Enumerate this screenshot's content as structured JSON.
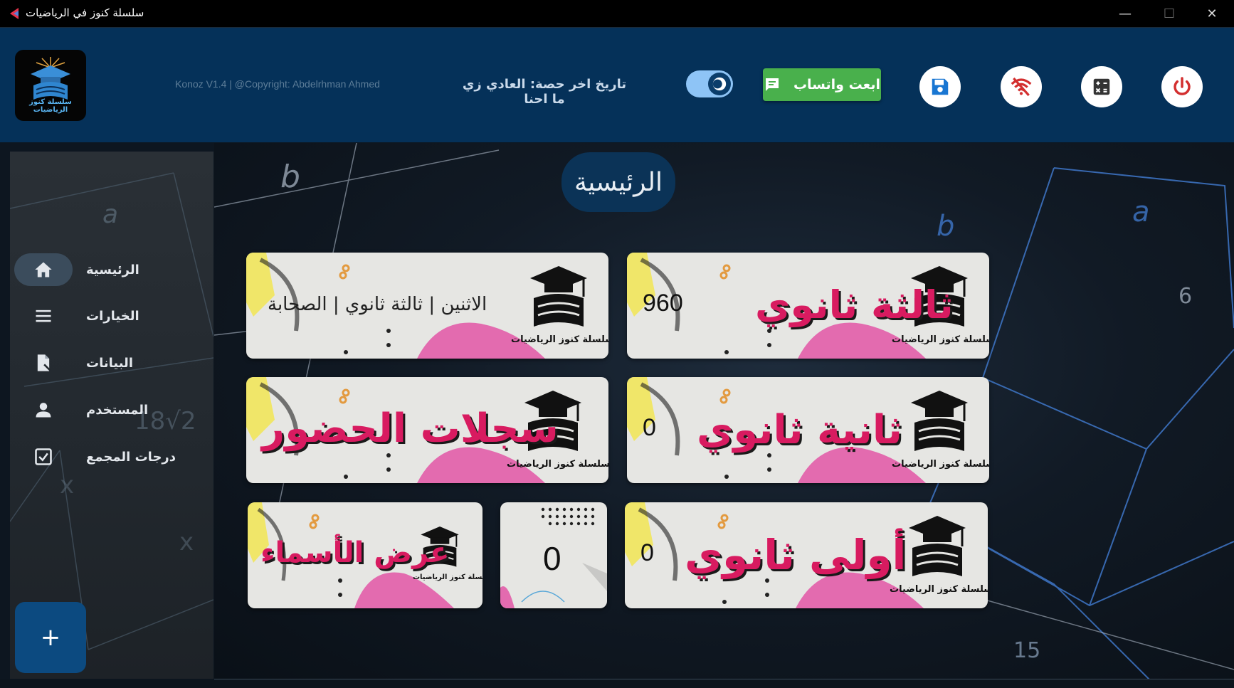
{
  "window": {
    "title": "سلسلة كنوز في الرياضيات",
    "controls": {
      "minimize": "—",
      "maximize": "☐",
      "close": "✕"
    }
  },
  "header": {
    "logo_text": "سلسلة كنوز الرياضيات",
    "copyright": "Konoz V1.4 | @Copyright: Abdelrhman Ahmed",
    "last_session": "تاريخ اخر حصة: العادي زي ما احنا",
    "dark_mode_toggle": {
      "on": true
    },
    "whatsapp_button": "ابعت واتساب",
    "icons": [
      "eye-icon",
      "chat-icon",
      "save-icon",
      "wifi-off-icon",
      "calculator-icon",
      "power-icon"
    ],
    "accent": "#053159"
  },
  "sidebar": {
    "items": [
      {
        "label": "الرئيسية",
        "icon": "home-icon",
        "active": true
      },
      {
        "label": "الخيارات",
        "icon": "menu-icon",
        "active": false
      },
      {
        "label": "البيانات",
        "icon": "file-icon",
        "active": false
      },
      {
        "label": "المستخدم",
        "icon": "user-icon",
        "active": false
      },
      {
        "label": "درجات المجمع",
        "icon": "checkbox-icon",
        "active": false
      }
    ],
    "fab": "+"
  },
  "main": {
    "page_title": "الرئيسية",
    "brand": "سلسلة كنوز الرياضيات",
    "cards": {
      "third_secondary": {
        "title": "ثالثة ثانوي",
        "value": "960"
      },
      "schedule": {
        "text": "الاثنين | ثالثة ثانوي | الصحابة"
      },
      "second_secondary": {
        "title": "ثانية ثانوي",
        "value": "0"
      },
      "attendance": {
        "title": "سجلات الحضور"
      },
      "first_secondary": {
        "title": "أولى ثانوي",
        "value": "0"
      },
      "counter": {
        "value": "0"
      },
      "names": {
        "title": "عرض الأسماء"
      }
    },
    "colors": {
      "card_title": "#d81b60",
      "card_bg": "#e6e6e3"
    }
  }
}
